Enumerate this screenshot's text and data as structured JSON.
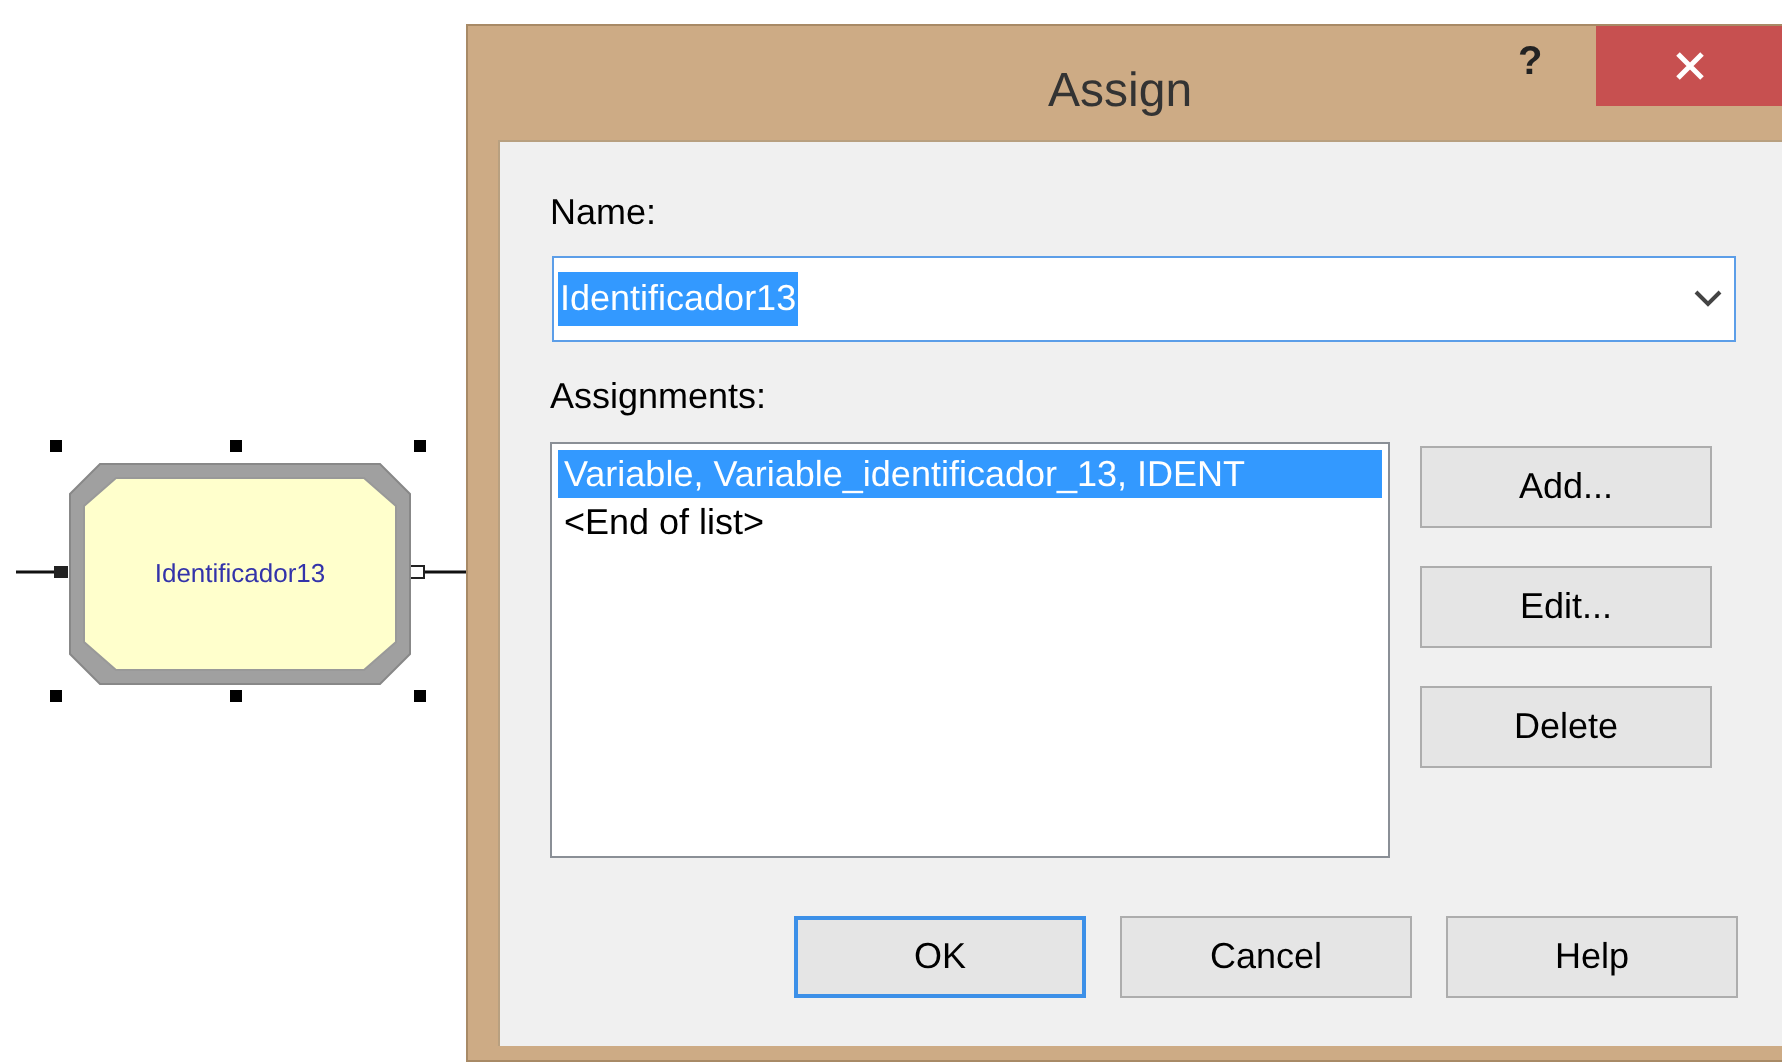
{
  "canvas": {
    "module": {
      "label": "Identificador13",
      "selected": true
    }
  },
  "dialog": {
    "title": "Assign",
    "help_glyph": "?",
    "name_field": {
      "label": "Name:",
      "value": "Identificador13",
      "text_selected": true
    },
    "assignments": {
      "label": "Assignments:",
      "items": [
        {
          "text": "Variable, Variable_identificador_13, IDENT",
          "selected": true
        },
        {
          "text": "<End of list>",
          "selected": false
        }
      ]
    },
    "side_buttons": [
      "Add...",
      "Edit...",
      "Delete"
    ],
    "buttons": [
      {
        "label": "OK",
        "default": true
      },
      {
        "label": "Cancel",
        "default": false
      },
      {
        "label": "Help",
        "default": false
      }
    ]
  }
}
